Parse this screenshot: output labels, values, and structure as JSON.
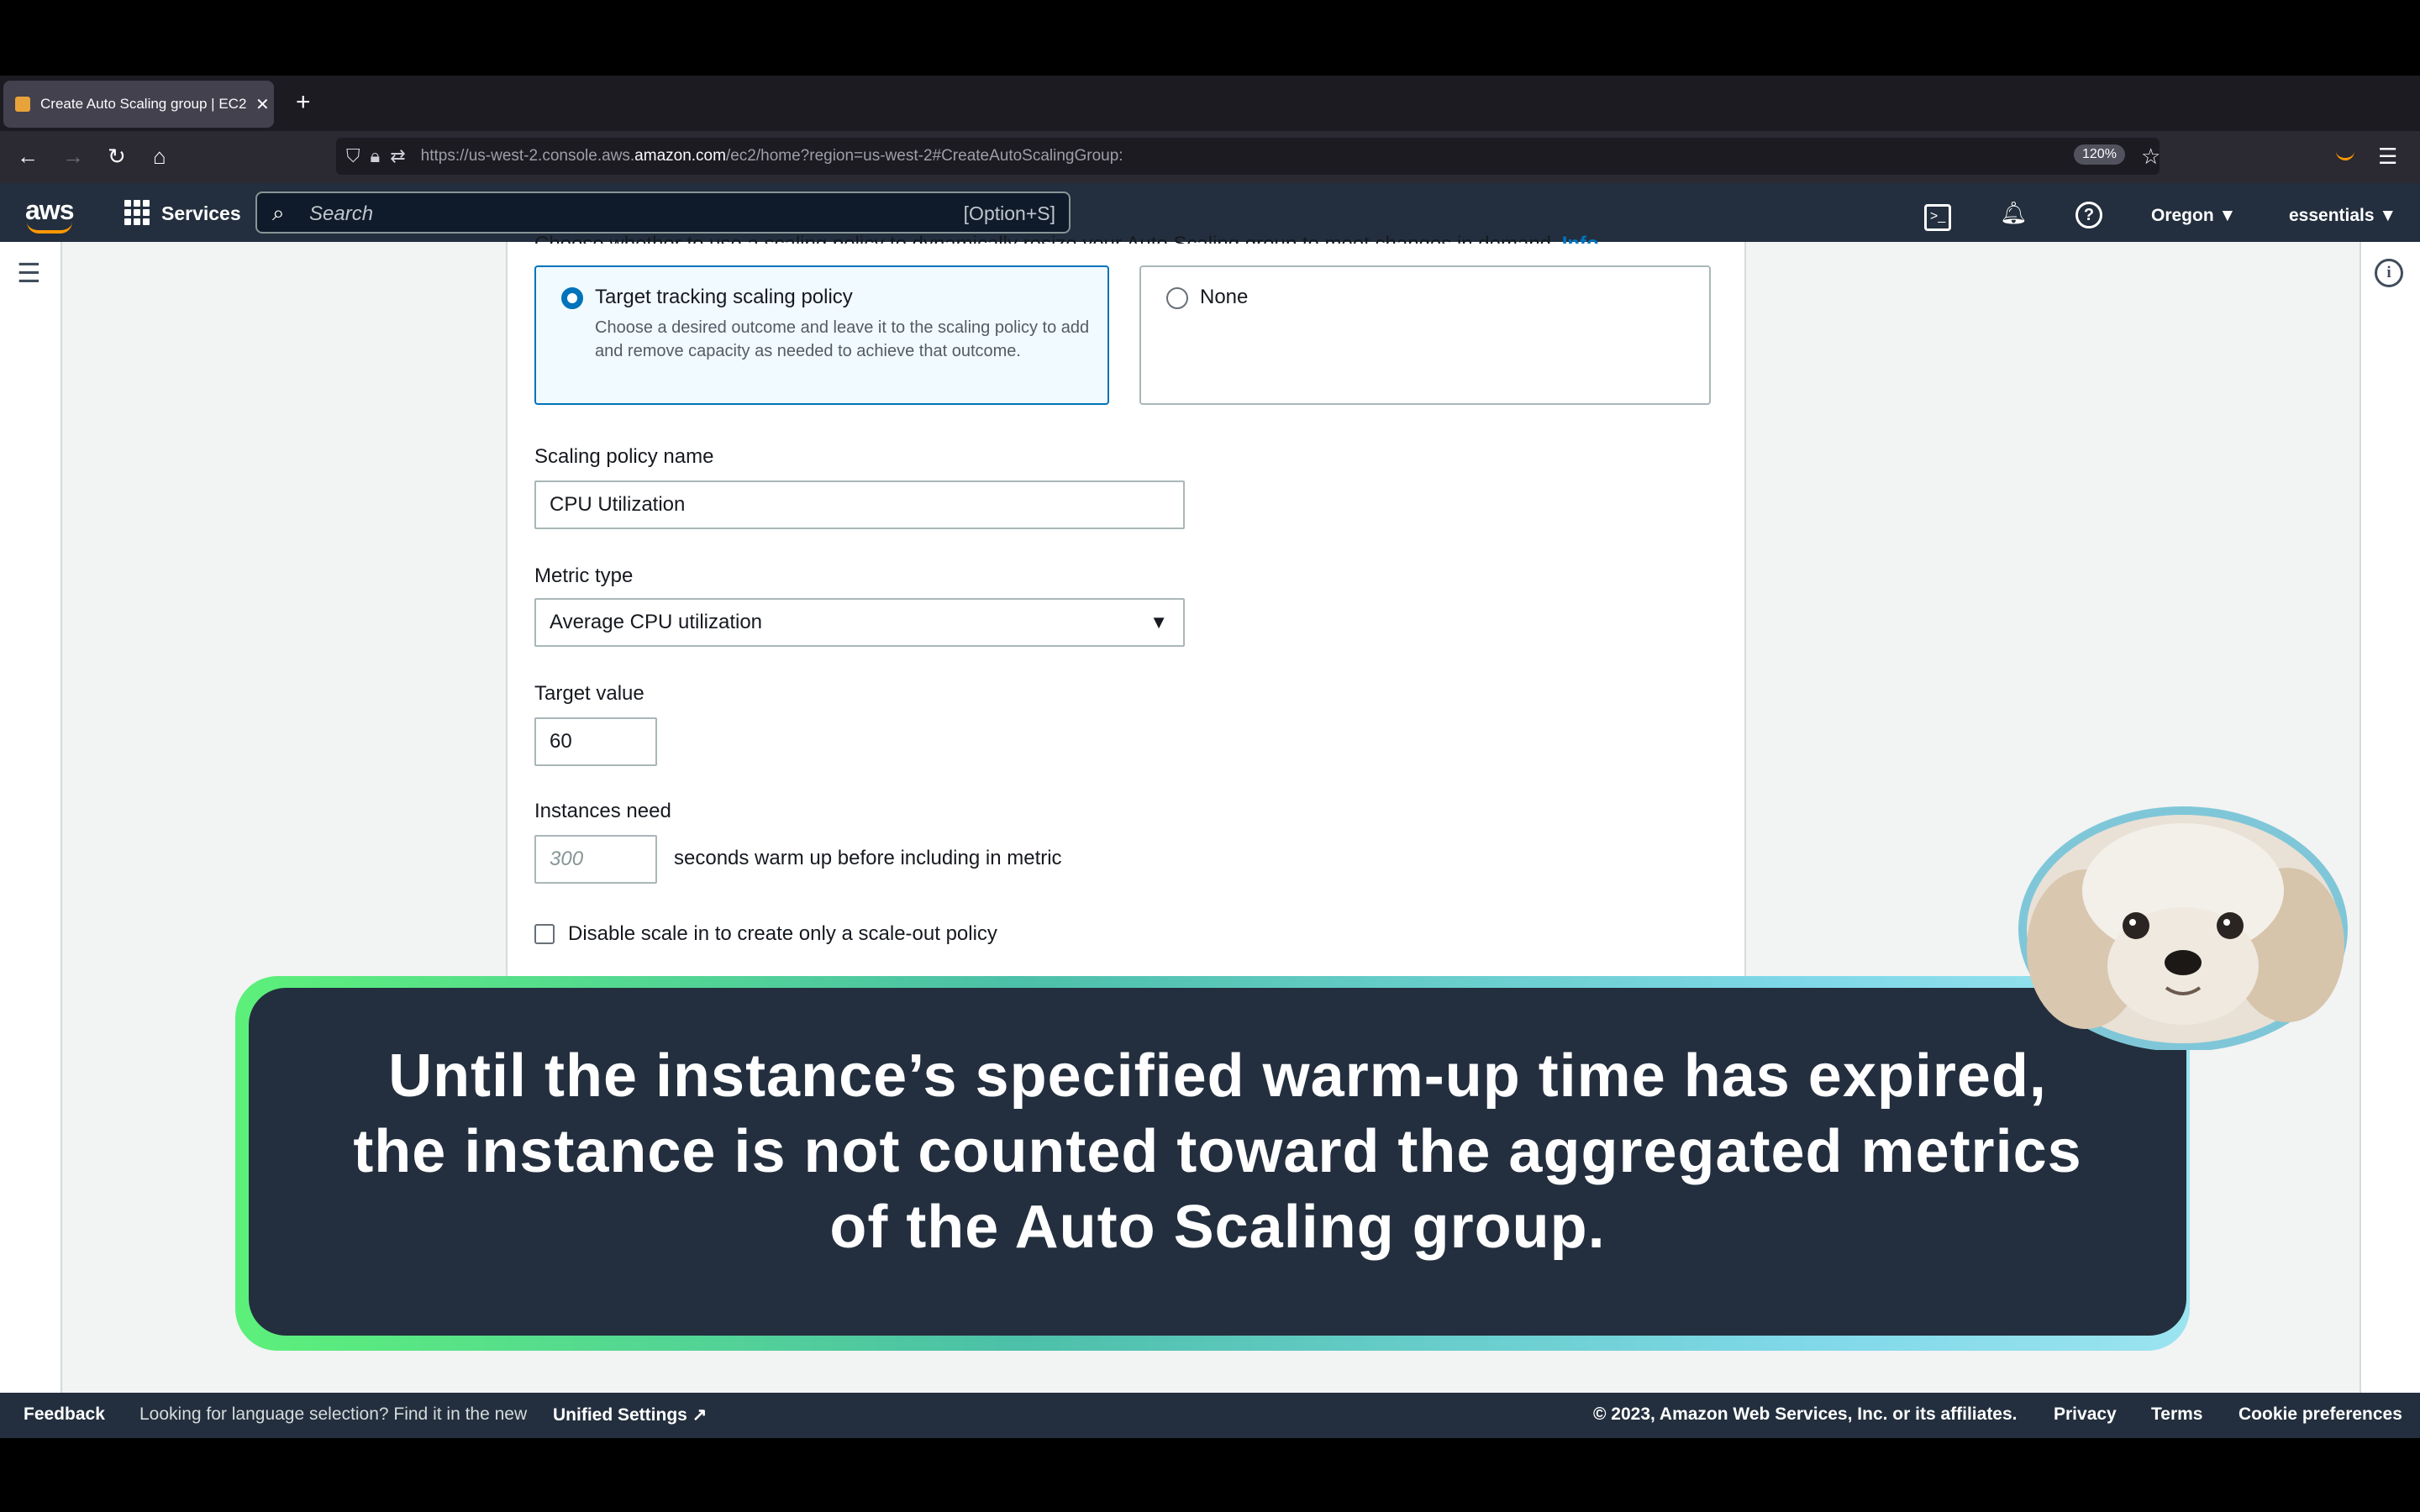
{
  "browser": {
    "tab_title": "Create Auto Scaling group | EC2",
    "tab_close": "✕",
    "new_tab": "+",
    "url_prefix": "https://us-west-2.console.aws.",
    "url_host": "amazon.com",
    "url_suffix": "/ec2/home?region=us-west-2#CreateAutoScalingGroup:",
    "zoom": "120%"
  },
  "aws_nav": {
    "logo": "aws",
    "services": "Services",
    "search_placeholder": "Search",
    "search_shortcut": "[Option+S]",
    "region": "Oregon ▼",
    "account": "essentials ▼"
  },
  "form": {
    "cut_off_text": "Choose whether to use a scaling policy to dynamically resize your Auto Scaling group to meet changes in demand.",
    "info_link": "Info",
    "option_target": {
      "title": "Target tracking scaling policy",
      "description": "Choose a desired outcome and leave it to the scaling policy to add and remove capacity as needed to achieve that outcome.",
      "selected": true
    },
    "option_none": {
      "title": "None",
      "selected": false
    },
    "policy_name_label": "Scaling policy name",
    "policy_name_value": "CPU Utilization",
    "metric_type_label": "Metric type",
    "metric_type_value": "Average CPU utilization",
    "target_value_label": "Target value",
    "target_value": "60",
    "warmup_label": "Instances need",
    "warmup_placeholder": "300",
    "warmup_suffix": "seconds warm up before including in metric",
    "disable_scale_in_label": "Disable scale in to create only a scale-out policy"
  },
  "caption": {
    "line1": "Until the instance’s specified warm-up time has expired,",
    "line2": "the instance is not counted toward the aggregated metrics",
    "line3": "of the Auto Scaling group."
  },
  "footer": {
    "feedback": "Feedback",
    "language_prompt": "Looking for language selection? Find it in the new",
    "unified_settings": "Unified Settings",
    "copyright": "© 2023, Amazon Web Services, Inc. or its affiliates.",
    "privacy": "Privacy",
    "terms": "Terms",
    "cookie": "Cookie preferences"
  },
  "colors": {
    "aws_nav": "#232f3e",
    "accent_blue": "#0073bb",
    "aws_orange": "#ff9900",
    "caption_border": "#5cf07a"
  }
}
